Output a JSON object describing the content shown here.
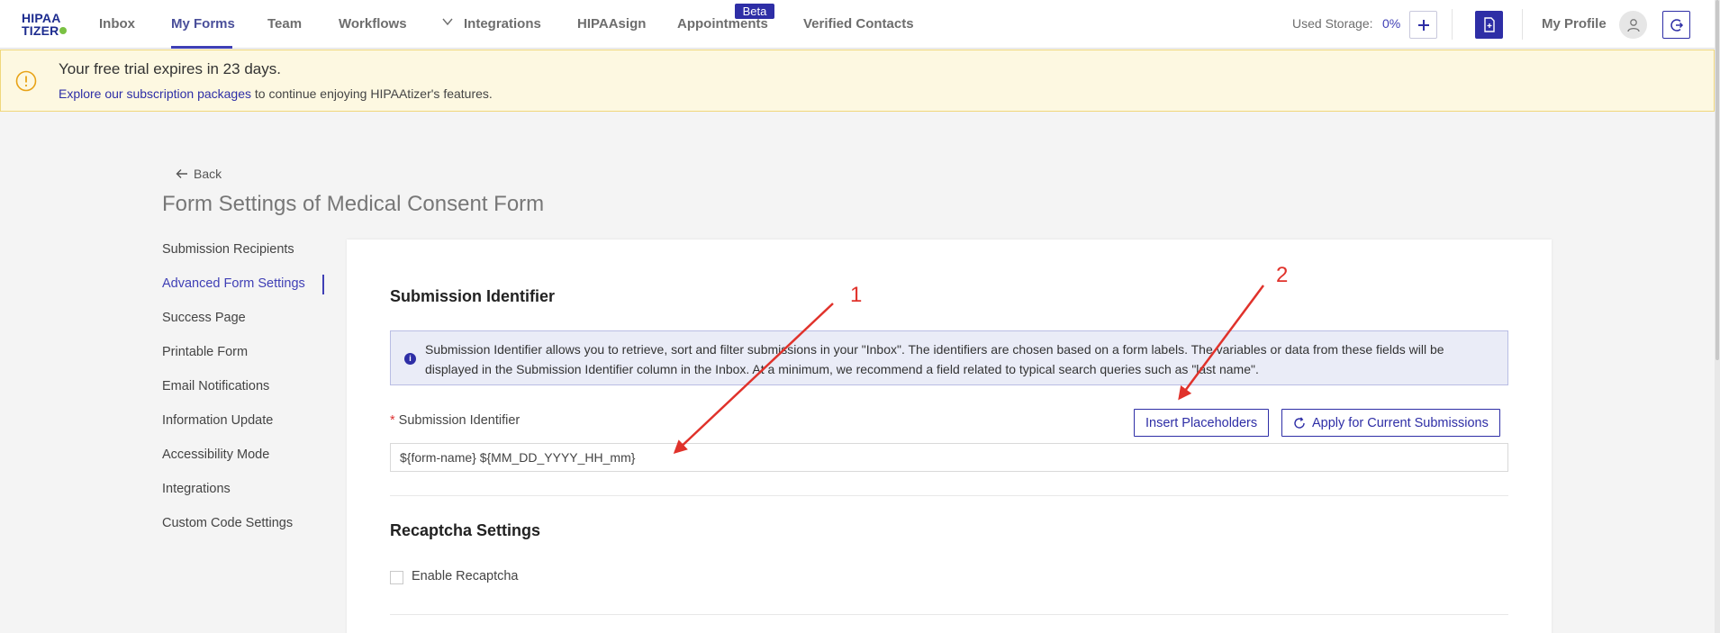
{
  "logo": {
    "line1": "HIPAA",
    "line2": "TIZER"
  },
  "nav": {
    "items": [
      "Inbox",
      "My Forms",
      "Team",
      "Workflows",
      "Integrations",
      "HIPAAsign",
      "Appointments",
      "Verified Contacts"
    ],
    "active": "My Forms",
    "beta_badge": "Beta",
    "storage_label": "Used Storage:",
    "storage_value": "0%",
    "profile_label": "My Profile"
  },
  "banner": {
    "title": "Your free trial expires in 23 days.",
    "link_text": "Explore our subscription packages",
    "rest_text": " to continue enjoying HIPAAtizer's features."
  },
  "page": {
    "back_label": "Back",
    "title": "Form Settings of Medical Consent Form"
  },
  "sidebar": {
    "items": [
      {
        "label": "Submission Recipients"
      },
      {
        "label": "Advanced Form Settings"
      },
      {
        "label": "Success Page"
      },
      {
        "label": "Printable Form"
      },
      {
        "label": "Email Notifications"
      },
      {
        "label": "Information Update"
      },
      {
        "label": "Accessibility Mode"
      },
      {
        "label": "Integrations"
      },
      {
        "label": "Custom Code Settings"
      }
    ],
    "active_index": 1
  },
  "submission_identifier": {
    "section_title": "Submission Identifier",
    "info_text": "Submission Identifier allows you to retrieve, sort and filter submissions in your \"Inbox\". The identifiers are chosen based on a form labels. The variables or data from these fields will be displayed in the Submission Identifier column in the Inbox. At a minimum, we recommend a field related to typical search queries such as \"last name\".",
    "field_label": "Submission Identifier",
    "required_mark": "*",
    "insert_button": "Insert Placeholders",
    "apply_button": "Apply for Current Submissions",
    "field_value": "${form-name} ${MM_DD_YYYY_HH_mm}"
  },
  "recaptcha": {
    "section_title": "Recaptcha Settings",
    "checkbox_label": "Enable Recaptcha",
    "checked": false
  },
  "annotations": {
    "labels": [
      "1",
      "2"
    ],
    "color": "#e0322b"
  },
  "colors": {
    "accent": "#2e2ea6",
    "banner_bg": "#fdf8e1",
    "banner_border": "#f0d77b",
    "info_bg": "#eaecf7"
  }
}
